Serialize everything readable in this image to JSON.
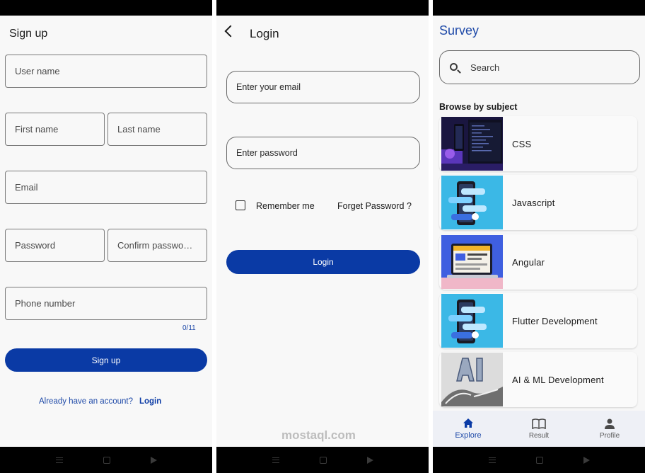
{
  "signup": {
    "title": "Sign up",
    "user_name_placeholder": "User name",
    "first_name_placeholder": "First name",
    "last_name_placeholder": "Last name",
    "email_placeholder": "Email",
    "password_placeholder": "Password",
    "confirm_password_placeholder": "Confirm passwo…",
    "phone_placeholder": "Phone number",
    "phone_counter": "0/11",
    "signup_button": "Sign up",
    "have_account_text": "Already have an account?",
    "login_link": "Login"
  },
  "login": {
    "title": "Login",
    "email_placeholder": "Enter your email",
    "password_placeholder": "Enter password",
    "remember_me": "Remember me",
    "forget_password": "Forget Password ?",
    "login_button": "Login"
  },
  "survey": {
    "title": "Survey",
    "search_placeholder": "Search",
    "browse_label": "Browse by subject",
    "subjects": [
      {
        "label": "CSS"
      },
      {
        "label": "Javascript"
      },
      {
        "label": "Angular"
      },
      {
        "label": "Flutter Development"
      },
      {
        "label": "AI & ML Development"
      }
    ],
    "nav": {
      "explore": "Explore",
      "result": "Result",
      "profile": "Profile"
    }
  },
  "watermark": {
    "text": "mostaql.com"
  },
  "colors": {
    "accent": "#0a3aa5",
    "link": "#1f4aa8"
  }
}
